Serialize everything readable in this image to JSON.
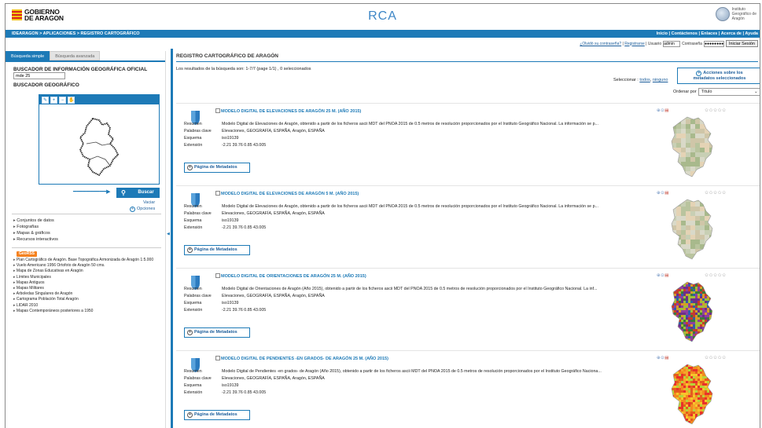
{
  "header": {
    "logo_line1": "GOBIERNO",
    "logo_line2": "DE ARAGON",
    "app_title": "RCA",
    "inst_line1": "Instituto",
    "inst_line2": "Geográfico de",
    "inst_line3": "Aragón"
  },
  "topbar": {
    "breadcrumb": "IDEARAGON  >  APLICACIONES  >  REGISTRO CARTOGRÁFICO",
    "nav": "Inicio | Contáctenos | Enlaces | Acerca de | Ayuda"
  },
  "login": {
    "forgot": "¿Olvidó su contraseña?",
    "register": "Registrarse",
    "user_label": "Usuario",
    "user_value": "admin",
    "pass_label": "Contraseña",
    "pass_value": "●●●●●●●●",
    "login_button": "Iniciar Sesión"
  },
  "left": {
    "tab_simple": "Búsqueda simple",
    "tab_advanced": "Búsqueda avanzada",
    "section1_title": "BUSCADOR DE INFORMACIÓN GEOGRÁFICA OFICIAL",
    "search_value": "mde 25",
    "section2_title": "BUSCADOR GEOGRÁFICO",
    "buscar_label": "Buscar",
    "vaciar_label": "Vaciar",
    "opciones_label": "Opciones",
    "categories": [
      "Conjuntos de datos",
      "Fotografías",
      "Mapas & gráficos",
      "Recursos interactivos"
    ],
    "geo_badge": "GeoRSS",
    "geo_items": [
      "Plan Cartográfico de Aragón. Base Topográfica Armonizada de Aragón 1:5.000",
      "Vuelo Americano 1956 Ortofoto de Aragón 50 cms.",
      "Mapa de Zonas Educativas en Aragón",
      "Límites Municipales",
      "Mapas Antiguos",
      "Mapas Militares",
      "Arboledas Singulares de Aragón",
      "Cartograma Población Total Aragón",
      "LIDAR 2010",
      "Mapas Contemporáneos posteriores a 1950"
    ]
  },
  "results": {
    "title": "REGISTRO CARTOGRÁFICO DE ARAGÓN",
    "count_text": "Los resultados de la búsqueda son:   1-7/7   (page 1/1) ,   0 seleccionados",
    "actions_line1": "Acciones sobre los",
    "actions_line2": "metadatos seleccionados",
    "select_label": "Seleccionar :",
    "select_all": "todos",
    "select_none": "ninguno",
    "order_label": "Ordenar por",
    "order_value": "Título",
    "labels": {
      "resumen": "Resumen",
      "palabras": "Palabras clave",
      "esquema": "Esquema",
      "extension": "Extensión",
      "meta_button": "Página de Metadatos"
    },
    "items": [
      {
        "title": "MODELO DIGITAL DE ELEVACIONES DE ARAGÓN 25 M. (AÑO 2015)",
        "resumen": "Modelo Digital de Elevaciones de Aragón, obtenido a partir de los ficheros ascii MDT del PNOA 2015 de 0.5 metros de resolución proporcionados por el Instituto Geográfico Nacional. La información se p...",
        "palabras": "Elevaciones, GEOGRAFÍA, ESPAÑA, Aragón, ESPAÑA",
        "esquema": "iso19139",
        "extension": "-2.21 39.76 0.85 43.005",
        "thumb": "elevation"
      },
      {
        "title": "MODELO DIGITAL DE ELEVACIONES DE ARAGÓN 5 M. (AÑO 2015)",
        "resumen": "Modelo Digital de Elevaciones de Aragón, obtenido a partir de los ficheros ascii MDT del PNOA 2015 de 0.5 metros de resolución proporcionados por el Instituto Geográfico Nacional. La información se p...",
        "palabras": "Elevaciones, GEOGRAFÍA, ESPAÑA, Aragón, ESPAÑA",
        "esquema": "iso19139",
        "extension": "-2.21 39.76 0.85 43.005",
        "thumb": "elevation"
      },
      {
        "title": "MODELO DIGITAL DE ORIENTACIONES DE ARAGÓN 25 M. (AÑO 2015)",
        "resumen": "Modelo Digital de Orientaciones de Aragón (Año 2015), obtenido a partir de los ficheros ascii MDT del PNOA 2015 de 0.5 metros de resolución proporcionados por el Instituto Geográfico Nacional. La inf...",
        "palabras": "Elevaciones, GEOGRAFÍA, ESPAÑA, Aragón, ESPAÑA",
        "esquema": "iso19139",
        "extension": "-2.21 39.76 0.85 43.005",
        "thumb": "orientation"
      },
      {
        "title": "MODELO DIGITAL DE PENDIENTES -EN GRADOS- DE ARAGÓN 25 M. (AÑO 2015)",
        "resumen": "Modelo Digital de Pendientes -en grados- de Aragón (Año 2015), obtenido a partir de los ficheros ascii MDT del PNOA 2015 de 0.5 metros de resolución proporcionados por el Instituto Geográfico Naciona...",
        "palabras": "Elevaciones, GEOGRAFÍA, ESPAÑA, Aragón, ESPAÑA",
        "esquema": "iso19139",
        "extension": "-2.21 39.76 0.85 43.005",
        "thumb": "slope"
      }
    ]
  },
  "colors": {
    "accent": "#1d7ab7",
    "link": "#1d5e9b",
    "rss": "#f58220"
  }
}
